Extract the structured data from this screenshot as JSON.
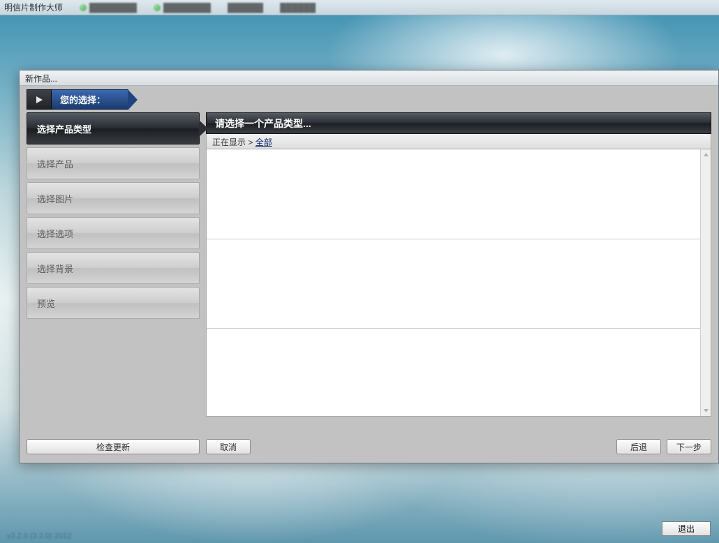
{
  "taskbar": {
    "app_title": "明信片制作大师",
    "items": [
      "",
      "",
      "",
      ""
    ]
  },
  "dialog": {
    "title": "新作品...",
    "choice_label": "您的选择：",
    "sidebar": {
      "steps": [
        {
          "label": "选择产品类型",
          "active": true
        },
        {
          "label": "选择产品",
          "active": false
        },
        {
          "label": "选择图片",
          "active": false
        },
        {
          "label": "选择选项",
          "active": false
        },
        {
          "label": "选择背景",
          "active": false
        },
        {
          "label": "预览",
          "active": false
        }
      ]
    },
    "content": {
      "header": "请选择一个产品类型...",
      "breadcrumb_prefix": "正在显示 > ",
      "breadcrumb_current": "全部"
    },
    "buttons": {
      "check_update": "检查更新",
      "cancel": "取消",
      "back": "后退",
      "next": "下一步"
    }
  },
  "footer": {
    "exit": "退出",
    "watermark": "v3.2.0 (3.2.0)   2012"
  }
}
